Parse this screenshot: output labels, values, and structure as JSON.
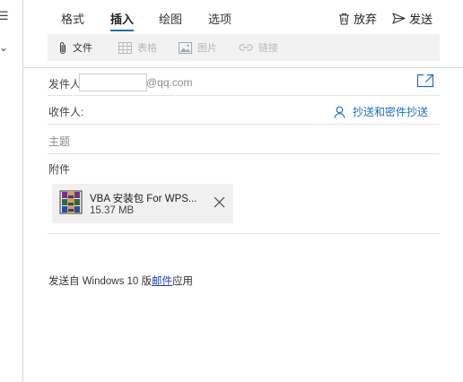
{
  "tabs": [
    "格式",
    "插入",
    "绘图",
    "选项"
  ],
  "active_tab": "插入",
  "actions": {
    "discard_label": "放弃",
    "send_label": "发送"
  },
  "ribbon": {
    "file_label": "文件",
    "table_label": "表格",
    "picture_label": "图片",
    "link_label": "链接"
  },
  "fields": {
    "from_label": "发件人",
    "from_value": "",
    "from_domain": "@qq.com",
    "to_label": "收件人:",
    "cc_bcc_label": "抄送和密件抄送",
    "subject_placeholder": "主题",
    "attachments_label": "附件"
  },
  "attachment": {
    "name": "VBA 安装包 For WPS...",
    "size": "15.37 MB"
  },
  "body": {
    "prefix": "发送自 Windows 10 版",
    "link": "邮件",
    "suffix": "应用"
  },
  "colors": {
    "accent": "#2b6cb0",
    "link": "#1a6fbd",
    "ribbon_bg": "#f2f2f2"
  }
}
